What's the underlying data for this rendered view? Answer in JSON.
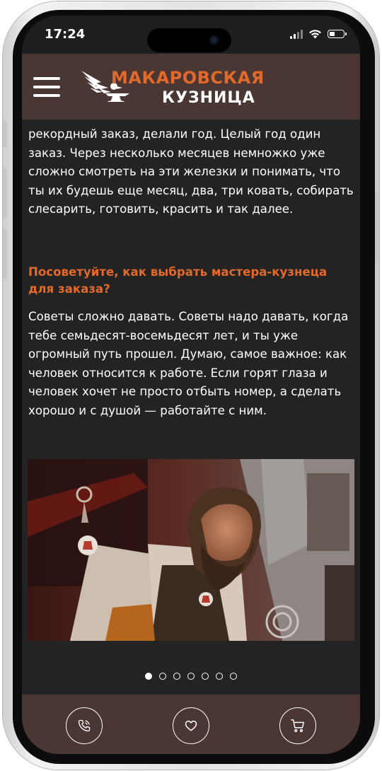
{
  "status_bar": {
    "time": "17:24"
  },
  "header": {
    "logo_line1": "МАКАРОВСКАЯ",
    "logo_line2": "КУЗНИЦА",
    "menu_icon": "hamburger-menu-icon"
  },
  "article": {
    "paragraph_1": "рекордный заказ, делали год. Целый год один заказ. Через несколько месяцев немножко уже сложно смотреть на эти железки и понимать, что ты их будешь еще месяц, два, три ковать, собирать слесарить, готовить, красить и так далее.",
    "heading": "Посоветуйте, как выбрать мастера-кузнеца для заказа?",
    "paragraph_2": "Советы сложно давать. Советы надо давать, когда тебе семьдесят-восемьдесят лет, и ты уже огромный путь прошел. Думаю, самое важное: как человек относится к работе. Если горят глаза и человек хочет не просто отбыть номер, а сделать хорошо и с душой — работайте с ним."
  },
  "gallery": {
    "slide_count": 7,
    "active_index": 0
  },
  "bottom_nav": {
    "items": [
      {
        "icon": "phone-icon"
      },
      {
        "icon": "heart-icon"
      },
      {
        "icon": "cart-icon"
      }
    ]
  },
  "colors": {
    "accent": "#e0692c",
    "header_bg": "#4a3633",
    "page_bg": "#242323",
    "text": "#ffffff"
  }
}
